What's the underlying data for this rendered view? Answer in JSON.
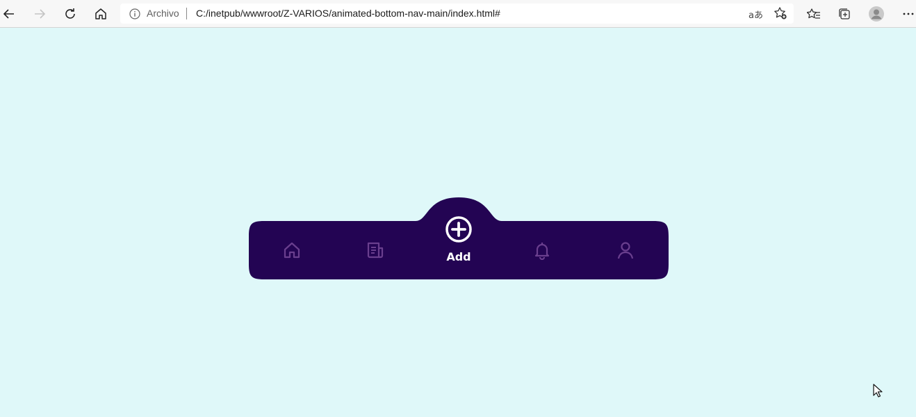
{
  "browser": {
    "back_icon": "back-arrow-icon",
    "forward_icon": "forward-arrow-icon",
    "reload_icon": "reload-icon",
    "home_icon": "home-icon",
    "site_label": "Archivo",
    "url": "C:/inetpub/wwwroot/Z-VARIOS/animated-bottom-nav-main/index.html#",
    "read_aloud_glyph": "aあ",
    "add_favorite_icon": "add-favorite-icon",
    "favorites_icon": "favorites-icon",
    "collections_icon": "collections-icon",
    "profile_icon": "profile-avatar",
    "menu_icon": "more-menu-icon"
  },
  "page": {
    "background_color": "#dff8f9",
    "nav": {
      "background_color": "#230453",
      "active_color": "#ffffff",
      "inactive_color": "#6a3f8e",
      "items": [
        {
          "name": "home",
          "icon": "home-icon",
          "active": false
        },
        {
          "name": "news",
          "icon": "newspaper-icon",
          "active": false
        },
        {
          "name": "add",
          "icon": "plus-circle-icon",
          "label": "Add",
          "active": true
        },
        {
          "name": "notifications",
          "icon": "bell-icon",
          "active": false
        },
        {
          "name": "profile",
          "icon": "user-icon",
          "active": false
        }
      ]
    }
  }
}
